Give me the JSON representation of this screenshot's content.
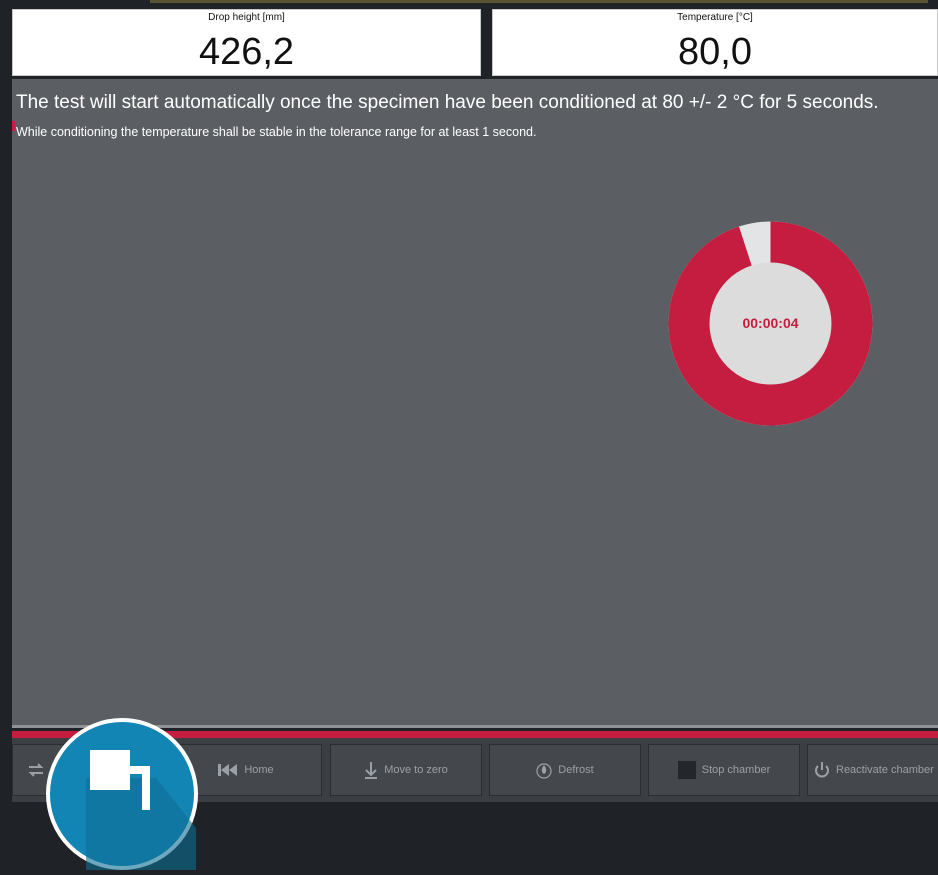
{
  "readouts": {
    "drop_height": {
      "label": "Drop height   [mm]",
      "value": "426,2"
    },
    "temperature": {
      "label": "Temperature   [°C]",
      "value": "80,0"
    }
  },
  "message": {
    "line1": "The test will start automatically once the specimen have been conditioned at 80 +/- 2 °C for 5 seconds.",
    "line2": "While conditioning the temperature shall be stable in the tolerance range for at least 1 second."
  },
  "timer": {
    "elapsed": "00:00:04",
    "progress_fraction": 0.95,
    "colors": {
      "fill": "#c51d3f",
      "track": "#e3e4e5",
      "center": "#dcdcdc"
    }
  },
  "footer": {
    "buttons": [
      {
        "label": "",
        "icon": "swap-arrows-icon"
      },
      {
        "label": "Home",
        "icon": "skip-to-start-icon"
      },
      {
        "label": "Move to zero",
        "icon": "arrow-down-to-line-icon"
      },
      {
        "label": "Defrost",
        "icon": "droplet-icon"
      },
      {
        "label": "Stop chamber",
        "icon": "stop-square-icon"
      },
      {
        "label": "Reactivate chamber",
        "icon": "power-icon"
      }
    ]
  },
  "colors": {
    "accent": "#c51d3f",
    "panel": "#5b5f63",
    "logo": "#1385b5"
  }
}
